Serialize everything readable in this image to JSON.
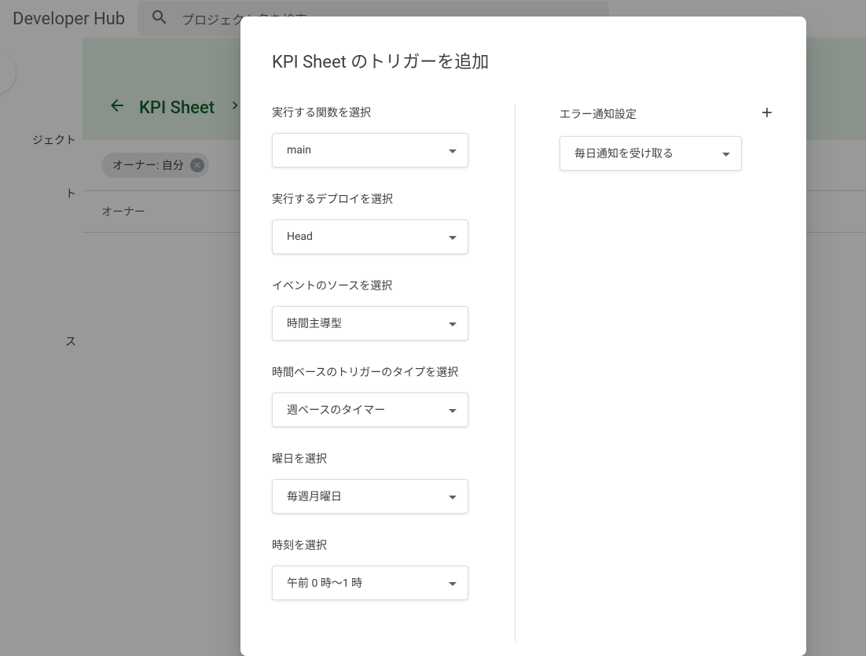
{
  "header": {
    "app_title": "Developer Hub",
    "search_placeholder": "プロジェクト名を検索"
  },
  "sidebar": {
    "items": [
      {
        "label": "ジェクト"
      },
      {
        "label": ""
      },
      {
        "label": "ト"
      },
      {
        "label": ""
      },
      {
        "label": ""
      },
      {
        "label": ""
      },
      {
        "label": ""
      },
      {
        "label": ""
      },
      {
        "label": ""
      },
      {
        "label": "ス"
      }
    ]
  },
  "content": {
    "project_title": "KPI Sheet",
    "filter_chip": "オーナー: 自分",
    "table_column_owner": "オーナー"
  },
  "modal": {
    "title": "KPI Sheet のトリガーを追加",
    "left": {
      "fields": [
        {
          "label": "実行する関数を選択",
          "value": "main"
        },
        {
          "label": "実行するデプロイを選択",
          "value": "Head"
        },
        {
          "label": "イベントのソースを選択",
          "value": "時間主導型"
        },
        {
          "label": "時間ベースのトリガーのタイプを選択",
          "value": "週ベースのタイマー"
        },
        {
          "label": "曜日を選択",
          "value": "毎週月曜日"
        },
        {
          "label": "時刻を選択",
          "value": "午前 0 時～1 時"
        }
      ]
    },
    "right": {
      "header_label": "エラー通知設定",
      "notification_value": "毎日通知を受け取る"
    }
  }
}
